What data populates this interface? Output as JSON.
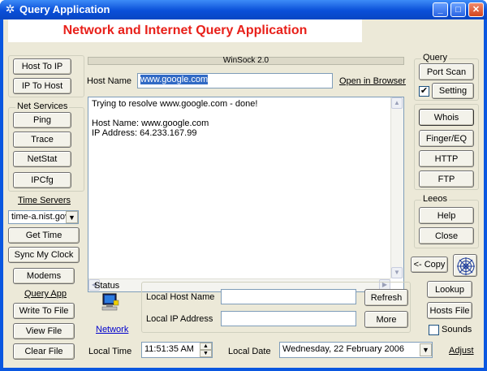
{
  "window": {
    "title": "Query Application",
    "icon": "network-web-icon"
  },
  "banner": {
    "text": "Network and Internet Query Application",
    "color": "#e8201a"
  },
  "left": {
    "host_to_ip": "Host To IP",
    "ip_to_host": "IP To Host",
    "net_services_label": "Net Services",
    "ping": "Ping",
    "trace": "Trace",
    "netstat": "NetStat",
    "ipcfg": "IPCfg",
    "time_servers_label": "Time Servers",
    "time_server_value": "time-a.nist.gov",
    "get_time": "Get Time",
    "sync_clock": "Sync My Clock",
    "modems": "Modems",
    "query_app_label": "Query App",
    "write_to_file": "Write To File",
    "view_file": "View File",
    "clear_file": "Clear File"
  },
  "center": {
    "winsock_label": "WinSock 2.0",
    "host_name_label": "Host Name",
    "host_name_value": "www.google.com",
    "open_in_browser": "Open in Browser",
    "output_lines": [
      "Trying to resolve www.google.com  - done!",
      "",
      "Host Name: www.google.com",
      "IP Address: 64.233.167.99"
    ],
    "status_label": "Status",
    "network_link": "Network",
    "local_host_name_label": "Local Host Name",
    "local_host_name_value": "",
    "local_ip_label": "Local IP Address",
    "local_ip_value": "",
    "refresh": "Refresh",
    "more": "More",
    "local_time_label": "Local Time",
    "local_time_value": "11:51:35 AM",
    "local_date_label": "Local Date",
    "local_date_value": "Wednesday, 22  February  2006",
    "adjust": "Adjust"
  },
  "right": {
    "query_label": "Query",
    "port_scan": "Port Scan",
    "setting": "Setting",
    "setting_checked": true,
    "whois": "Whois",
    "finger": "Finger/EQ",
    "http": "HTTP",
    "ftp": "FTP",
    "leeos_label": "Leeos",
    "help": "Help",
    "close": "Close",
    "copy": "<- Copy",
    "lookup": "Lookup",
    "hosts_file": "Hosts File",
    "sounds": "Sounds",
    "sounds_checked": false
  }
}
